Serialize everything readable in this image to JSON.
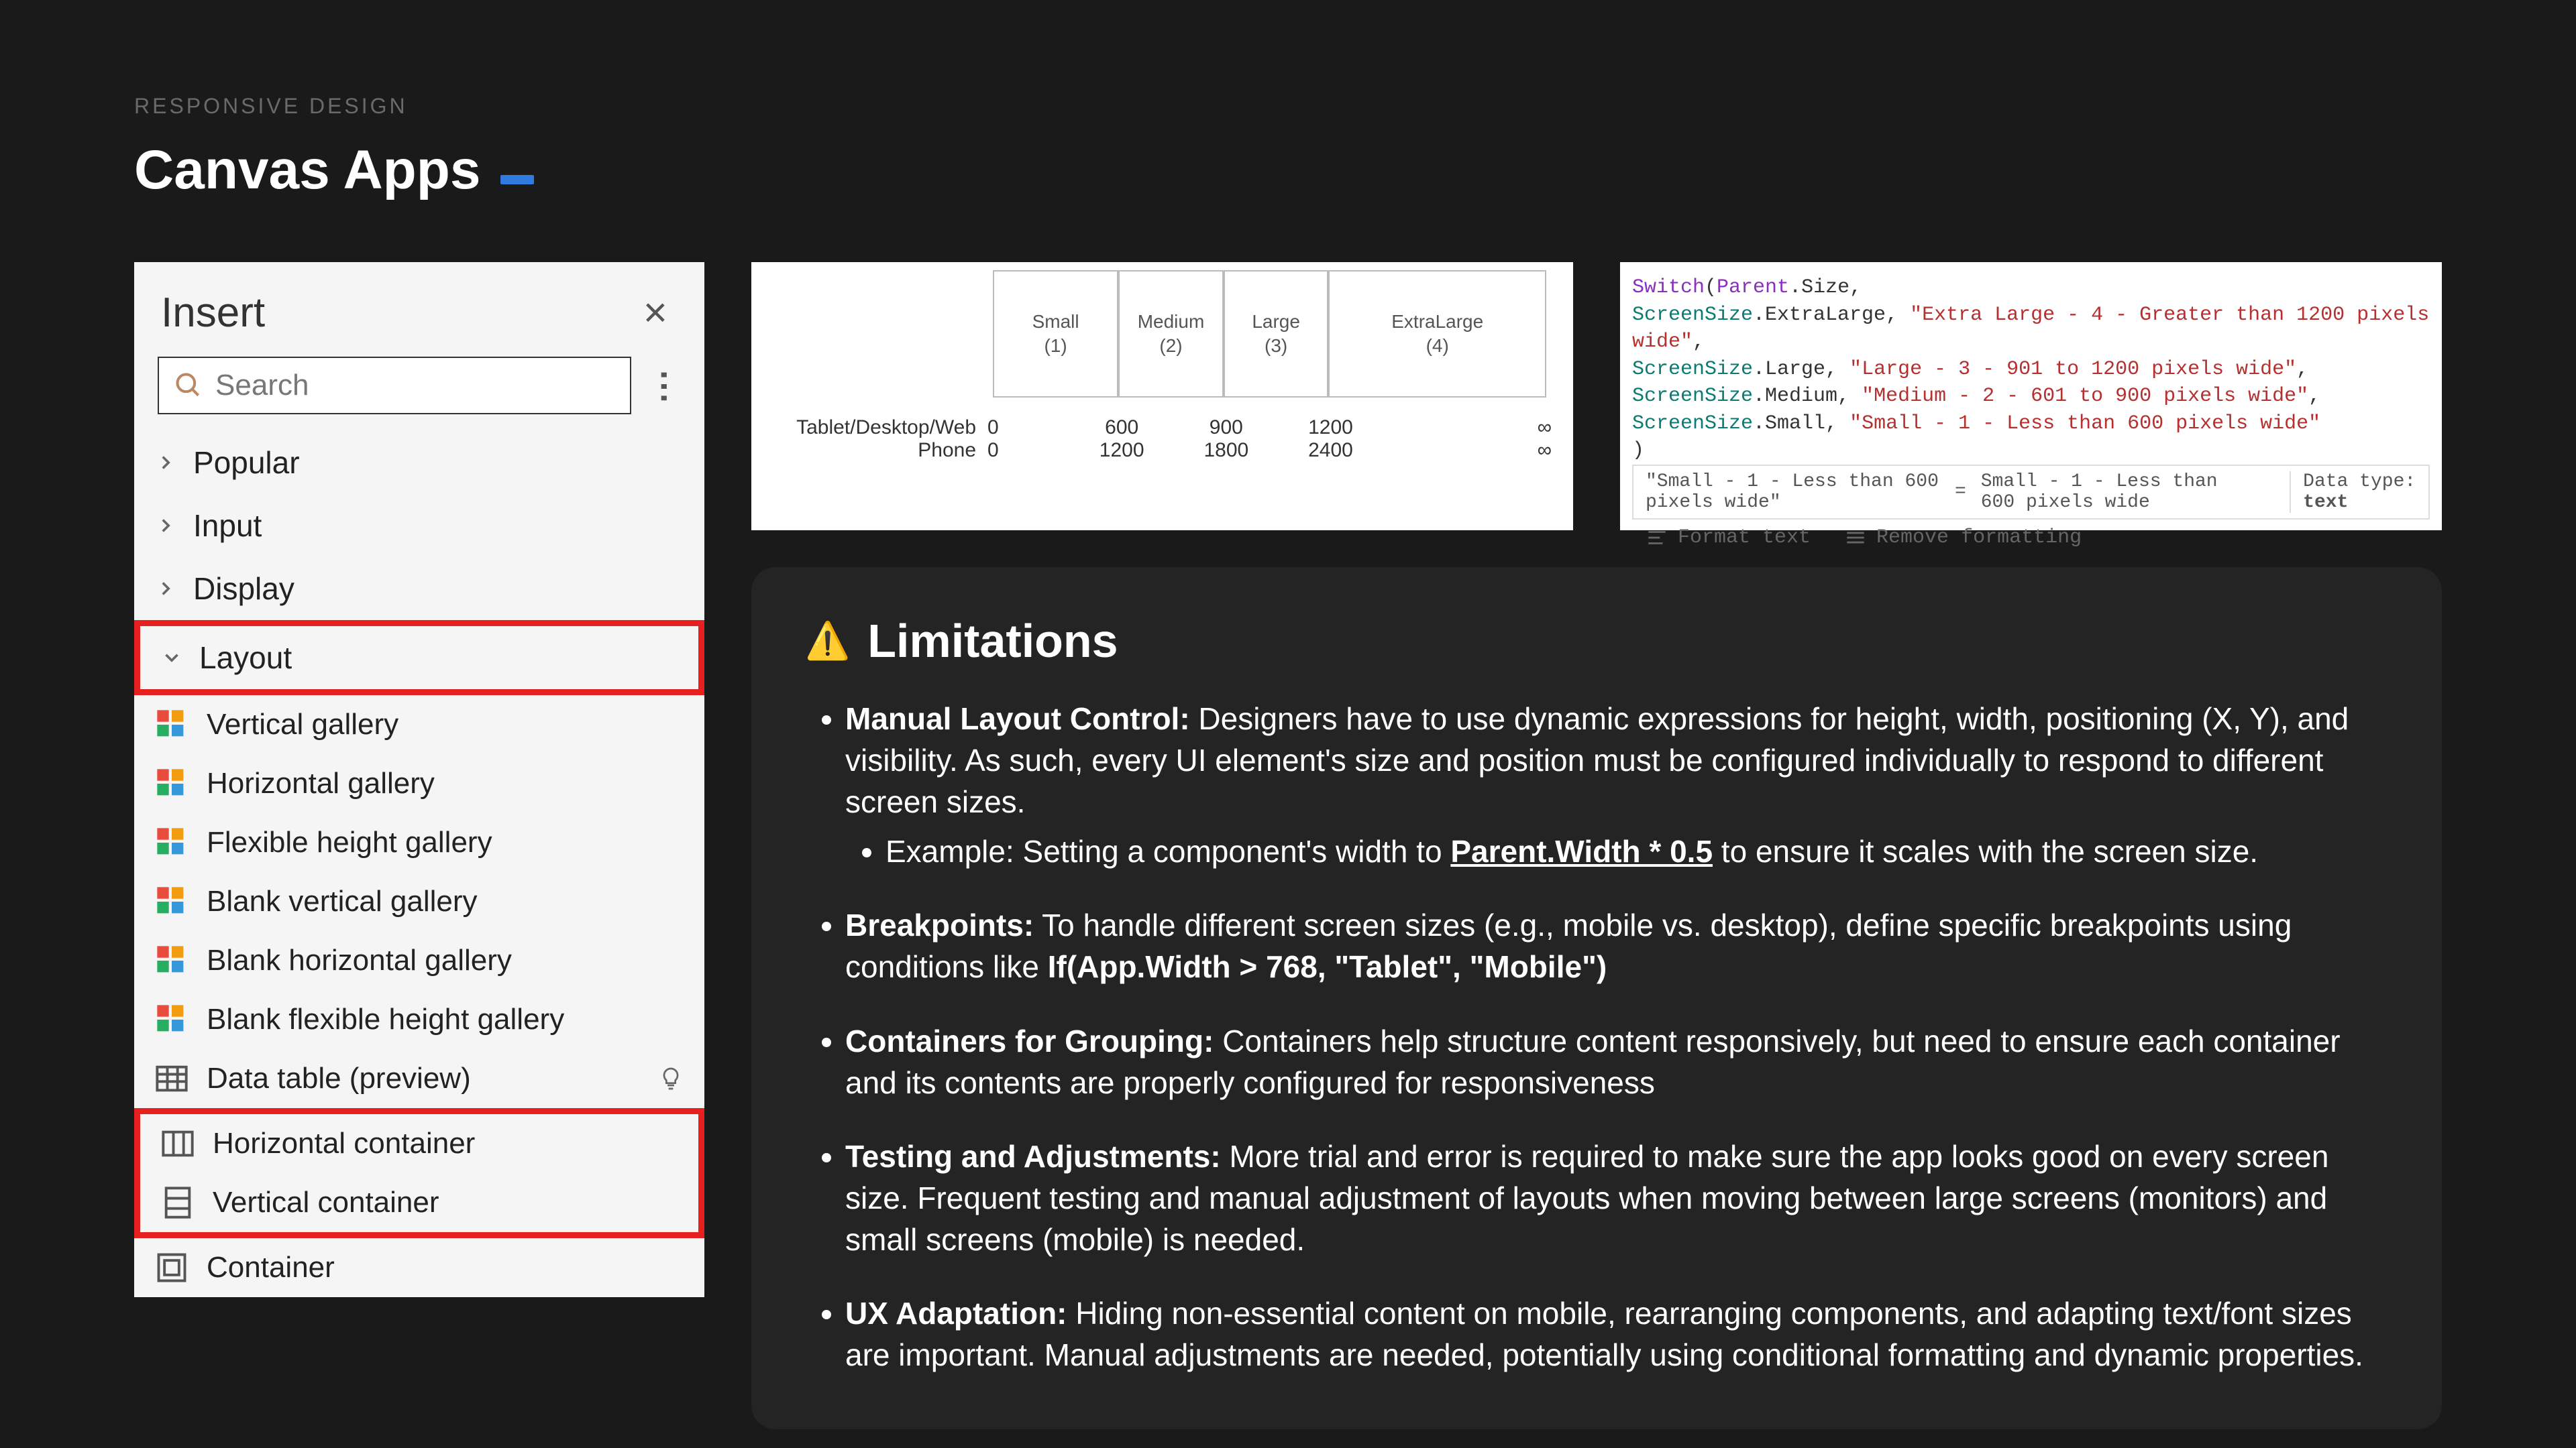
{
  "header": {
    "eyebrow": "RESPONSIVE DESIGN",
    "title": "Canvas Apps"
  },
  "insertPanel": {
    "title": "Insert",
    "searchPlaceholder": "Search",
    "categories": [
      {
        "label": "Popular",
        "expanded": false
      },
      {
        "label": "Input",
        "expanded": false
      },
      {
        "label": "Display",
        "expanded": false
      },
      {
        "label": "Layout",
        "expanded": true,
        "highlighted": true
      }
    ],
    "items": [
      {
        "label": "Vertical gallery",
        "icon": "gallery"
      },
      {
        "label": "Horizontal gallery",
        "icon": "gallery"
      },
      {
        "label": "Flexible height gallery",
        "icon": "gallery"
      },
      {
        "label": "Blank vertical gallery",
        "icon": "gallery"
      },
      {
        "label": "Blank horizontal gallery",
        "icon": "gallery"
      },
      {
        "label": "Blank flexible height gallery",
        "icon": "gallery"
      },
      {
        "label": "Data table (preview)",
        "icon": "datatable",
        "hint": true
      },
      {
        "label": "Horizontal container",
        "icon": "h-container",
        "hl": true
      },
      {
        "label": "Vertical container",
        "icon": "v-container",
        "hl": true
      },
      {
        "label": "Container",
        "icon": "container"
      }
    ]
  },
  "breakpointFigure": {
    "columns": [
      {
        "name": "Small",
        "num": "(1)",
        "weight": 1.2
      },
      {
        "name": "Medium",
        "num": "(2)",
        "weight": 1
      },
      {
        "name": "Large",
        "num": "(3)",
        "weight": 1
      },
      {
        "name": "ExtraLarge",
        "num": "(4)",
        "weight": 2.1
      }
    ],
    "rowLabels": [
      "Tablet/Desktop/Web",
      "Phone"
    ],
    "startCol": [
      "0",
      "0"
    ],
    "tickVals": [
      [
        "600",
        "1200"
      ],
      [
        "900",
        "1800"
      ],
      [
        "1200",
        "2400"
      ]
    ],
    "endCol": [
      "∞",
      "∞"
    ]
  },
  "codeFigure": {
    "lines": [
      [
        {
          "t": "Switch",
          "c": "tk-kw"
        },
        {
          "t": "("
        },
        {
          "t": "Parent",
          "c": "tk-kw"
        },
        {
          "t": ".Size,"
        }
      ],
      [
        {
          "t": "ScreenSize",
          "c": "tk-type"
        },
        {
          "t": ".ExtraLarge, "
        },
        {
          "t": "\"Extra Large - 4 - Greater than 1200 pixels wide\"",
          "c": "tk-str"
        },
        {
          "t": ","
        }
      ],
      [
        {
          "t": "ScreenSize",
          "c": "tk-type"
        },
        {
          "t": ".Large, "
        },
        {
          "t": "\"Large - 3 - 901 to 1200 pixels wide\"",
          "c": "tk-str"
        },
        {
          "t": ","
        }
      ],
      [
        {
          "t": "ScreenSize",
          "c": "tk-type"
        },
        {
          "t": ".Medium, "
        },
        {
          "t": "\"Medium - 2 - 601 to 900 pixels wide\"",
          "c": "tk-str"
        },
        {
          "t": ","
        }
      ],
      [
        {
          "t": "ScreenSize",
          "c": "tk-type"
        },
        {
          "t": ".Small, "
        },
        {
          "t": "\"Small - 1 - Less than 600 pixels wide\"",
          "c": "tk-str"
        }
      ],
      [
        {
          "t": ")"
        }
      ]
    ],
    "resultQuoted": "\"Small - 1 - Less than 600 pixels wide\"",
    "equals": "=",
    "resultVal": "Small - 1 - Less than 600 pixels wide",
    "dataTypeLabel": "Data type: ",
    "dataTypeVal": "text",
    "formatText": "Format text",
    "removeFormatting": "Remove formatting"
  },
  "limitations": {
    "title": "Limitations",
    "items": [
      {
        "lead": "Manual Layout Control:",
        "body": " Designers have to use dynamic expressions for height, width, positioning (X, Y), and visibility. As such, every UI element's size and position must be configured individually to respond to different screen sizes.",
        "sub": {
          "pre": "Example: Setting a component's width to ",
          "ul": "Parent.Width * 0.5",
          "post": " to ensure it scales with the screen size."
        }
      },
      {
        "lead": "Breakpoints:",
        "body": " To handle different screen sizes (e.g., mobile vs. desktop), define specific breakpoints using conditions like ",
        "bold2": "If(App.Width > 768, \"Tablet\", \"Mobile\")"
      },
      {
        "lead": "Containers for Grouping:",
        "body": " Containers help structure content responsively, but need to ensure each container and its contents are properly configured for responsiveness"
      },
      {
        "lead": "Testing and Adjustments:",
        "body": " More trial and error is required to make sure the app looks good on every screen size. Frequent testing and manual adjustment of layouts when moving between large screens (monitors) and small screens (mobile) is needed."
      },
      {
        "lead": "UX Adaptation:",
        "body": " Hiding non-essential content on mobile, rearranging components, and adapting text/font sizes are important. Manual adjustments are needed, potentially using conditional formatting and dynamic properties."
      }
    ]
  }
}
